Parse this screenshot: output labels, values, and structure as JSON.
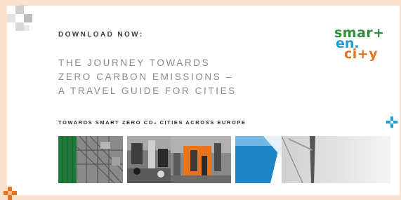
{
  "header": {
    "download_label": "DOWNLOAD NOW:"
  },
  "headline": {
    "lines": [
      "THE JOURNEY TOWARDS",
      "ZERO CARBON EMISSIONS –",
      "A TRAVEL GUIDE FOR CITIES"
    ]
  },
  "tagline": "TOWARDS SMART ZERO CO₂ CITIES ACROSS EUROPE",
  "logo": {
    "line1": "smar+",
    "line2": "en.",
    "line3": "ci+y",
    "colors": {
      "smart": "#2f8f3a",
      "en": "#1aa0d8",
      "city": "#e8741e"
    }
  },
  "photos": [
    {
      "name": "green-building-photo"
    },
    {
      "name": "city-traffic-photo"
    },
    {
      "name": "orange-crowd-photo"
    },
    {
      "name": "blue-facade-photo"
    },
    {
      "name": "wind-turbine-photo"
    }
  ],
  "colors": {
    "background": "#fbe3cf",
    "accent_orange": "#e8741e",
    "accent_blue": "#1aa0d8",
    "accent_green": "#2f8f3a"
  }
}
